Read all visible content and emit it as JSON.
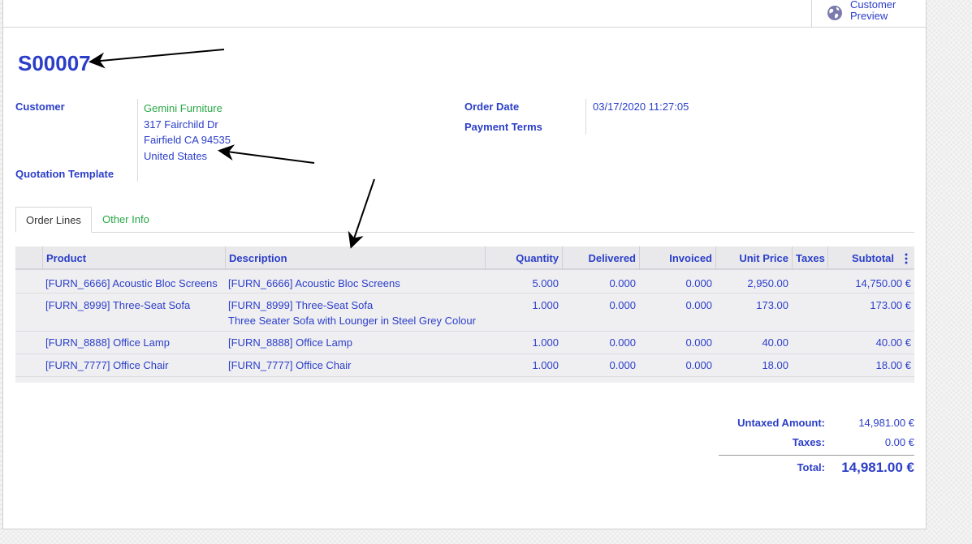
{
  "header": {
    "customer_preview_label": "Customer Preview",
    "customer_preview_icon": "globe-icon"
  },
  "order": {
    "name": "S00007",
    "customer_label": "Customer",
    "customer_name": "Gemini Furniture",
    "customer_street": "317 Fairchild Dr",
    "customer_city": "Fairfield CA 94535",
    "customer_country": "United States",
    "quotation_template_label": "Quotation Template",
    "order_date_label": "Order Date",
    "order_date_value": "03/17/2020 11:27:05",
    "payment_terms_label": "Payment Terms"
  },
  "tabs": [
    {
      "label": "Order Lines",
      "active": true
    },
    {
      "label": "Other Info",
      "active": false
    }
  ],
  "table": {
    "columns": [
      "Product",
      "Description",
      "Quantity",
      "Delivered",
      "Invoiced",
      "Unit Price",
      "Taxes",
      "Subtotal"
    ],
    "options_icon": "kebab-menu-icon",
    "rows": [
      {
        "product": "[FURN_6666] Acoustic Bloc Screens",
        "description": "[FURN_6666] Acoustic Bloc Screens",
        "description2": "",
        "quantity": "5.000",
        "delivered": "0.000",
        "invoiced": "0.000",
        "unit_price": "2,950.00",
        "taxes": "",
        "subtotal": "14,750.00 €"
      },
      {
        "product": "[FURN_8999] Three-Seat Sofa",
        "description": "[FURN_8999] Three-Seat Sofa",
        "description2": "Three Seater Sofa with Lounger in Steel Grey Colour",
        "quantity": "1.000",
        "delivered": "0.000",
        "invoiced": "0.000",
        "unit_price": "173.00",
        "taxes": "",
        "subtotal": "173.00 €"
      },
      {
        "product": "[FURN_8888] Office Lamp",
        "description": "[FURN_8888] Office Lamp",
        "description2": "",
        "quantity": "1.000",
        "delivered": "0.000",
        "invoiced": "0.000",
        "unit_price": "40.00",
        "taxes": "",
        "subtotal": "40.00 €"
      },
      {
        "product": "[FURN_7777] Office Chair",
        "description": "[FURN_7777] Office Chair",
        "description2": "",
        "quantity": "1.000",
        "delivered": "0.000",
        "invoiced": "0.000",
        "unit_price": "18.00",
        "taxes": "",
        "subtotal": "18.00 €"
      }
    ]
  },
  "totals": {
    "untaxed_label": "Untaxed Amount:",
    "untaxed_value": "14,981.00 €",
    "taxes_label": "Taxes:",
    "taxes_value": "0.00 €",
    "total_label": "Total:",
    "total_value": "14,981.00 €"
  },
  "colors": {
    "link_blue": "#2b3ec8",
    "green": "#28a745",
    "arrow": "#000000"
  }
}
